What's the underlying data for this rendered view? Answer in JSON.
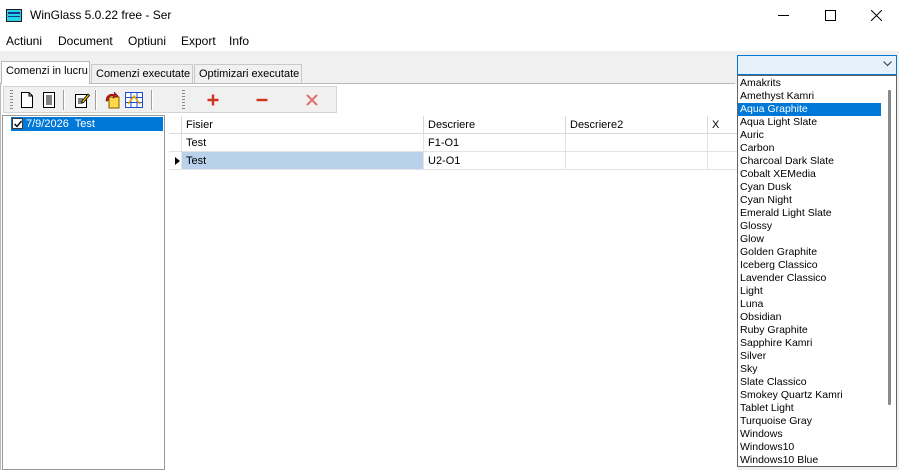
{
  "window": {
    "title": "WinGlass 5.0.22 free - Ser"
  },
  "menu": [
    "Actiuni",
    "Document",
    "Optiuni",
    "Export",
    "Info"
  ],
  "tabs": [
    "Comenzi in lucru",
    "Comenzi executate",
    "Optimizari executate"
  ],
  "tree": {
    "node_label": "7/9/2026  Test",
    "checked": true
  },
  "grid": {
    "columns": [
      "Fisier",
      "Descriere",
      "Descriere2",
      "X"
    ],
    "rows": [
      {
        "fisier": "Test",
        "descriere": "F1-O1",
        "descriere2": "",
        "x": ""
      },
      {
        "fisier": "Test",
        "descriere": "U2-O1",
        "descriere2": "",
        "x": ""
      }
    ]
  },
  "theme_combo": {
    "value": ""
  },
  "theme_list": {
    "selected": "Aqua Graphite",
    "items": [
      "Amakrits",
      "Amethyst Kamri",
      "Aqua Graphite",
      "Aqua Light Slate",
      "Auric",
      "Carbon",
      "Charcoal Dark Slate",
      "Cobalt XEMedia",
      "Cyan Dusk",
      "Cyan Night",
      "Emerald Light Slate",
      "Glossy",
      "Glow",
      "Golden Graphite",
      "Iceberg Classico",
      "Lavender Classico",
      "Light",
      "Luna",
      "Obsidian",
      "Ruby Graphite",
      "Sapphire Kamri",
      "Silver",
      "Sky",
      "Slate Classico",
      "Smokey Quartz Kamri",
      "Tablet Light",
      "Turquoise Gray",
      "Windows",
      "Windows10",
      "Windows10 Blue"
    ]
  },
  "colors": {
    "accent": "#0078d7",
    "selection": "#b9d1ea",
    "add": "#d0341c",
    "remove": "#d0341c",
    "delete": "#e06060"
  }
}
